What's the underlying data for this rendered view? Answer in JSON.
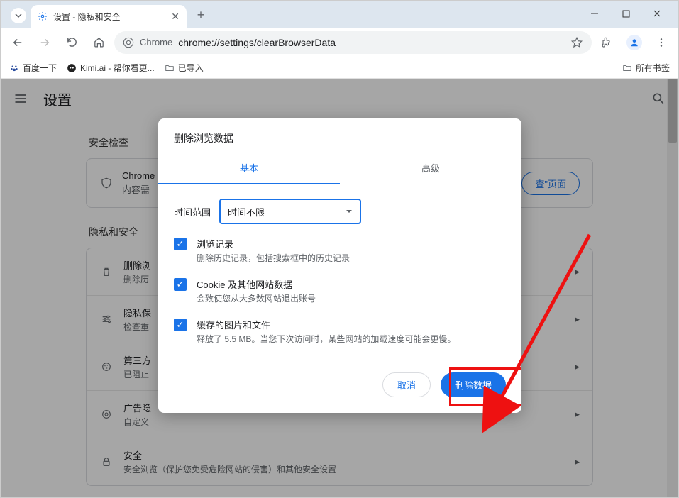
{
  "window": {
    "tab_title": "设置 - 隐私和安全"
  },
  "toolbar": {
    "omni_label": "Chrome",
    "url": "chrome://settings/clearBrowserData"
  },
  "bookmarks": {
    "items": [
      {
        "label": "百度一下"
      },
      {
        "label": "Kimi.ai - 帮你看更..."
      },
      {
        "label": "已导入"
      }
    ],
    "all_label": "所有书签"
  },
  "settings": {
    "title": "设置",
    "section_safety": "安全检查",
    "chrome_card_title": "Chrome",
    "chrome_card_sub": "内容需",
    "chrome_card_btn": "查\"页面",
    "section_privacy": "隐私和安全",
    "rows": [
      {
        "title": "删除浏",
        "sub": "删除历"
      },
      {
        "title": "隐私保",
        "sub": "检查重"
      },
      {
        "title": "第三方",
        "sub": "已阻止"
      },
      {
        "title": "广告隐",
        "sub": "自定义"
      },
      {
        "title": "安全",
        "sub": "安全浏览（保护您免受危险网站的侵害）和其他安全设置"
      }
    ]
  },
  "dialog": {
    "title": "删除浏览数据",
    "tab_basic": "基本",
    "tab_advanced": "高级",
    "time_label": "时间范围",
    "time_value": "时间不限",
    "items": [
      {
        "title": "浏览记录",
        "sub": "删除历史记录，包括搜索框中的历史记录"
      },
      {
        "title": "Cookie 及其他网站数据",
        "sub": "会致使您从大多数网站退出账号"
      },
      {
        "title": "缓存的图片和文件",
        "sub": "释放了 5.5 MB。当您下次访问时，某些网站的加载速度可能会更慢。"
      }
    ],
    "cancel": "取消",
    "confirm": "删除数据"
  }
}
